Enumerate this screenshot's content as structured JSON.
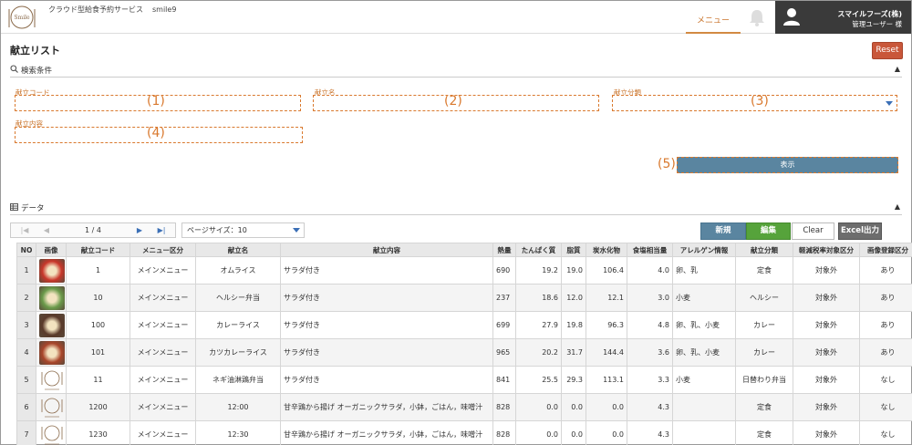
{
  "header": {
    "logo_text": "Smile",
    "app_name": "クラウド型給食予約サービス",
    "app_code": "smile9",
    "menu_tab": "メニュー",
    "company": "スマイルフーズ(株)",
    "user_role": "管理ユーザー 様"
  },
  "page": {
    "title": "献立リスト",
    "reset_label": "Reset"
  },
  "search": {
    "section_label": "検索条件",
    "fields": [
      {
        "label": "献立コード",
        "marker": "(1)"
      },
      {
        "label": "献立名",
        "marker": "(2)"
      },
      {
        "label": "献立分類",
        "marker": "(3)"
      },
      {
        "label": "献立内容",
        "marker": "(4)"
      }
    ],
    "show_marker": "(5)",
    "show_label": "表示"
  },
  "data_section": {
    "label": "データ"
  },
  "pager": {
    "page_text": "1 / 4",
    "page_size_label": "ページサイズ：10"
  },
  "actions": {
    "new": "新規",
    "edit": "編集",
    "clear": "Clear",
    "excel": "Excel出力"
  },
  "table": {
    "headers": [
      "NO",
      "画像",
      "献立コード",
      "メニュー区分",
      "献立名",
      "献立内容",
      "熱量",
      "たんぱく質",
      "脂質",
      "炭水化物",
      "食塩相当量",
      "アレルゲン情報",
      "献立分類",
      "軽減税率対象区分",
      "画像登録区分"
    ],
    "rows": [
      {
        "no": "1",
        "image": "photo",
        "color": "#c8372a",
        "code": "1",
        "menu_kubun": "メインメニュー",
        "name": "オムライス",
        "content": "サラダ付き",
        "kcal": "690",
        "protein": "19.2",
        "fat": "19.0",
        "carb": "106.4",
        "salt": "4.0",
        "allergen": "卵、乳",
        "category": "定食",
        "tax": "対象外",
        "img_reg": "あり"
      },
      {
        "no": "2",
        "image": "photo",
        "color": "#6a9a4a",
        "code": "10",
        "menu_kubun": "メインメニュー",
        "name": "ヘルシー弁当",
        "content": "サラダ付き",
        "kcal": "237",
        "protein": "18.6",
        "fat": "12.0",
        "carb": "12.1",
        "salt": "3.0",
        "allergen": "小麦",
        "category": "ヘルシー",
        "tax": "対象外",
        "img_reg": "あり"
      },
      {
        "no": "3",
        "image": "photo",
        "color": "#5a3a2a",
        "code": "100",
        "menu_kubun": "メインメニュー",
        "name": "カレーライス",
        "content": "サラダ付き",
        "kcal": "699",
        "protein": "27.9",
        "fat": "19.8",
        "carb": "96.3",
        "salt": "4.8",
        "allergen": "卵、乳、小麦",
        "category": "カレー",
        "tax": "対象外",
        "img_reg": "あり"
      },
      {
        "no": "4",
        "image": "photo",
        "color": "#a8452a",
        "code": "101",
        "menu_kubun": "メインメニュー",
        "name": "カツカレーライス",
        "content": "サラダ付き",
        "kcal": "965",
        "protein": "20.2",
        "fat": "31.7",
        "carb": "144.4",
        "salt": "3.6",
        "allergen": "卵、乳、小麦",
        "category": "カレー",
        "tax": "対象外",
        "img_reg": "あり"
      },
      {
        "no": "5",
        "image": "logo",
        "color": "#8a6a4a",
        "code": "11",
        "menu_kubun": "メインメニュー",
        "name": "ネギ油淋鶏弁当",
        "content": "サラダ付き",
        "kcal": "841",
        "protein": "25.5",
        "fat": "29.3",
        "carb": "113.1",
        "salt": "3.3",
        "allergen": "小麦",
        "category": "日替わり弁当",
        "tax": "対象外",
        "img_reg": "なし"
      },
      {
        "no": "6",
        "image": "logo",
        "color": "#8a6a4a",
        "code": "1200",
        "menu_kubun": "メインメニュー",
        "name": "12:00",
        "content": "甘辛鶏から揚げ オーガニックサラダ，小鉢，ごはん，味噌汁",
        "kcal": "828",
        "protein": "0.0",
        "fat": "0.0",
        "carb": "0.0",
        "salt": "4.3",
        "allergen": "",
        "category": "定食",
        "tax": "対象外",
        "img_reg": "なし"
      },
      {
        "no": "7",
        "image": "logo",
        "color": "#8a6a4a",
        "code": "1230",
        "menu_kubun": "メインメニュー",
        "name": "12:30",
        "content": "甘辛鶏から揚げ オーガニックサラダ，小鉢，ごはん，味噌汁",
        "kcal": "828",
        "protein": "0.0",
        "fat": "0.0",
        "carb": "0.0",
        "salt": "4.3",
        "allergen": "",
        "category": "定食",
        "tax": "対象外",
        "img_reg": "なし"
      }
    ]
  }
}
